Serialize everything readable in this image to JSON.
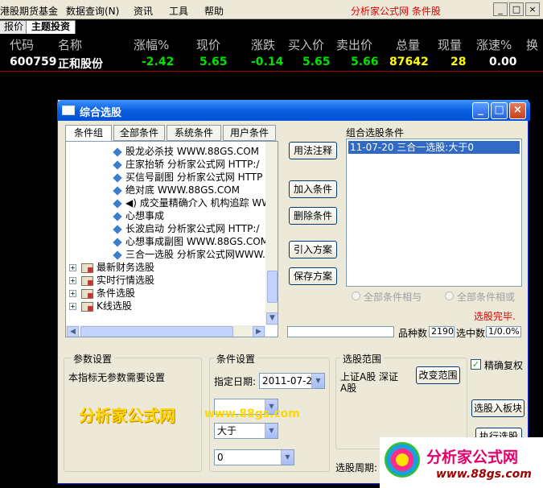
{
  "menubar": {
    "items": [
      "港股期货基金",
      "数据查询(N)",
      "资讯",
      "工具",
      "帮助"
    ],
    "title": "分析家公式网 条件股",
    "controls": [
      "_",
      "□",
      "×"
    ]
  },
  "tabs": [
    "报价",
    "主题投资"
  ],
  "quote": {
    "headers": [
      "代码",
      "名称",
      "涨幅%",
      "现价",
      "涨跌",
      "买入价",
      "卖出价",
      "总量",
      "现量",
      "涨速%",
      "换"
    ],
    "row": {
      "code": "600759",
      "name": "正和股份",
      "change_pct": "-2.42",
      "price": "5.65",
      "change": "-0.14",
      "bid": "5.65",
      "ask": "5.66",
      "volume": "87642",
      "cur_vol": "28",
      "speed": "0.00"
    }
  },
  "dialog": {
    "title": "综合选股",
    "left_tabs": [
      "条件组",
      "全部条件",
      "系统条件",
      "用户条件"
    ],
    "tree_items": [
      {
        "label": "股龙必杀技  WWW.88GS.COM",
        "kind": "formula"
      },
      {
        "label": "庄家抬轿  分析家公式网 HTTP:/",
        "kind": "formula"
      },
      {
        "label": "买信号副图  分析家公式网 HTTP",
        "kind": "formula"
      },
      {
        "label": "绝对底  WWW.88GS.COM",
        "kind": "formula"
      },
      {
        "label": "◀) 成交量精确介入 机构追踪 WW",
        "kind": "formula"
      },
      {
        "label": "心想事成",
        "kind": "formula"
      },
      {
        "label": "长波启动  分析家公式网 HTTP:/",
        "kind": "formula"
      },
      {
        "label": "心想事成副图  WWW.88GS.COM",
        "kind": "formula"
      },
      {
        "label": "三合一选股  分析家公式网WWW.8",
        "kind": "formula"
      }
    ],
    "tree_groups": [
      "最新财务选股",
      "实时行情选股",
      "条件选股",
      "K线选股"
    ],
    "buttons": {
      "usage": "用法注释",
      "add": "加入条件",
      "delete": "删除条件",
      "import": "引入方案",
      "save": "保存方案",
      "change_range": "改变范围",
      "to_block": "选股入板块",
      "execute": "执行选股"
    },
    "combined_label": "组合选股条件",
    "combined_items": [
      "11-07-20 三合一选股:大于0"
    ],
    "radio_and": "全部条件相与",
    "radio_or": "全部条件相或",
    "status": "选股完毕.",
    "count_label": "品种数",
    "count_value": "2190",
    "selected_label": "选中数",
    "selected_value": "1/0.0%",
    "params": {
      "legend": "参数设置",
      "text": "本指标无参数需要设置"
    },
    "cond": {
      "legend": "条件设置",
      "date_label": "指定日期:",
      "date_value": "2011-07-20",
      "combo1": "",
      "op": "大于",
      "value": "0"
    },
    "range": {
      "legend": "选股范围",
      "text1": "上证A股 深证",
      "text2": "A股",
      "period_label": "选股周期:"
    },
    "checkbox_label": "精确复权",
    "checkbox_checked": true
  },
  "watermark": {
    "text1": "分析家公式网",
    "text2": "www.88gs.com"
  },
  "logo": {
    "line1": "分析家公式网",
    "line2": "www.88gs.com"
  }
}
